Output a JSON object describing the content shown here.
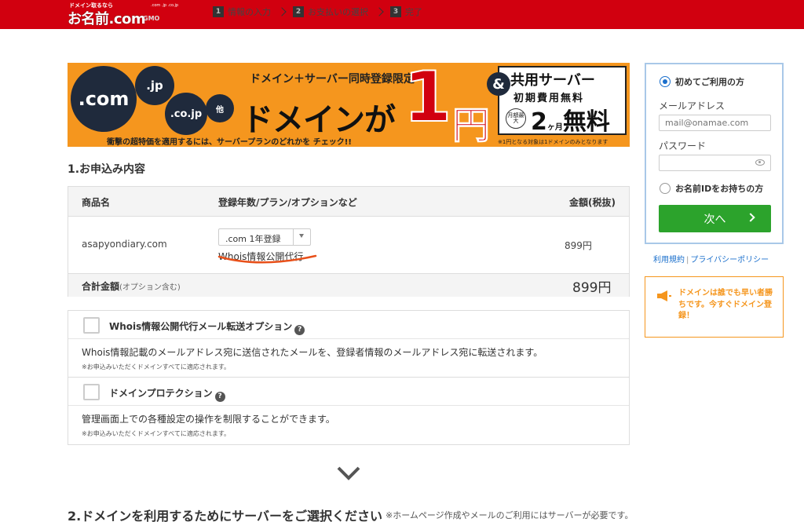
{
  "header": {
    "logo_tagline": "ドメイン取るなら",
    "logo_name": "お名前.com",
    "logo_tlds": ".com .jp .co.jp",
    "logo_brand": "GMO",
    "steps": [
      {
        "num": "1",
        "label": "情報の入力"
      },
      {
        "num": "2",
        "label": "お支払いの選択"
      },
      {
        "num": "3",
        "label": "完了"
      }
    ]
  },
  "banner": {
    "tld1": ".com",
    "tld2": ".jp",
    "tld3": ".co.jp",
    "tld_other": "他",
    "headline": "ドメイン＋サーバー同時登録限定",
    "main": "ドメインが",
    "price_num": "1",
    "price_unit": "円",
    "amp": "&",
    "box_title": "共用サーバー",
    "box_sub": "初期費用無料",
    "box_badge": "月額最大",
    "box_big": "2",
    "box_unit": "ヶ月",
    "box_free": "無料",
    "sub": "衝撃の超特価を適用するには、サーバープランのどれかを チェック!!",
    "note": "※1円となる対象は1ドメインのみとなります"
  },
  "order": {
    "section_title": "1.お申込み内容",
    "col_product": "商品名",
    "col_plan": "登録年数/プラン/オプションなど",
    "col_price": "金額(税抜)",
    "domain": "asapyondiary.com",
    "plan_value": ".com 1年登録",
    "option_label": "Whois情報公開代行",
    "price": "899円",
    "total_label": "合計金額",
    "total_note": "(オプション含む)",
    "total_value": "899円"
  },
  "options": [
    {
      "title": "Whois情報公開代行メール転送オプション",
      "desc": "Whois情報記載のメールアドレス宛に送信されたメールを、登録者情報のメールアドレス宛に転送されます。",
      "note": "※お申込みいただくドメインすべてに適応されます。"
    },
    {
      "title": "ドメインプロテクション",
      "desc": "管理画面上での各種設定の操作を制限することができます。",
      "note": "※お申込みいただくドメインすべてに適応されます。"
    }
  ],
  "section2": {
    "title": "2.ドメインを利用するためにサーバーをご選択ください",
    "note": "※ホームページ作成やメールのご利用にはサーバーが必要です。"
  },
  "login": {
    "first_time_label": "初めてご利用の方",
    "email_label": "メールアドレス",
    "email_placeholder": "mail@onamae.com",
    "password_label": "パスワード",
    "has_id_label": "お名前IDをお持ちの方",
    "next_label": "次へ",
    "terms_link": "利用規約",
    "privacy_link": "プライバシーポリシー"
  },
  "promo": {
    "text": "ドメインは誰でも早い者勝ちです。今すぐドメイン登録！"
  },
  "colors": {
    "header_red": "#d1000f",
    "banner_orange": "#f5961e",
    "next_green": "#2ca32c",
    "link_blue": "#1a6fcc",
    "annotation_underline": "#e8501a"
  }
}
